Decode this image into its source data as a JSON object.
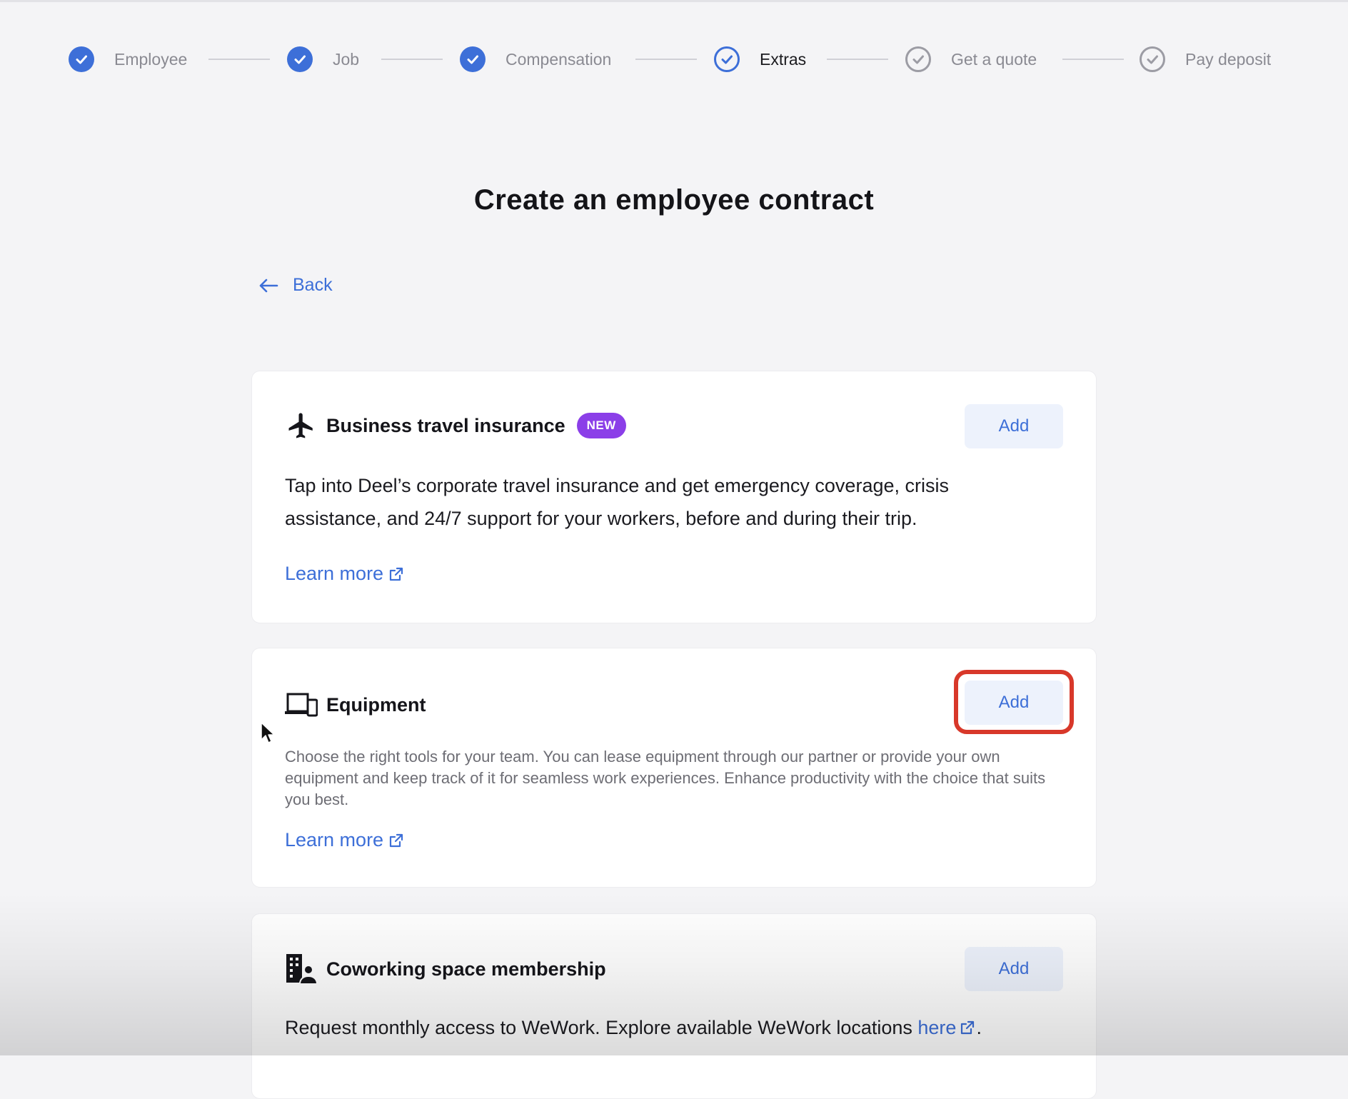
{
  "stepper": {
    "steps": [
      {
        "label": "Employee",
        "state": "done"
      },
      {
        "label": "Job",
        "state": "done"
      },
      {
        "label": "Compensation",
        "state": "done"
      },
      {
        "label": "Extras",
        "state": "active"
      },
      {
        "label": "Get a quote",
        "state": "todo"
      },
      {
        "label": "Pay deposit",
        "state": "todo"
      }
    ]
  },
  "page": {
    "title": "Create an employee contract",
    "back_label": "Back"
  },
  "cards": [
    {
      "icon": "airplane-icon",
      "title": "Business travel insurance",
      "badge": "NEW",
      "button": "Add",
      "description": "Tap into Deel’s corporate travel insurance and get emergency coverage, crisis assistance, and 24/7 support for your workers, before and during their trip.",
      "link": "Learn more"
    },
    {
      "icon": "devices-icon",
      "title": "Equipment",
      "button": "Add",
      "description": "Choose the right tools for your team. You can lease equipment through our partner or provide your own equipment and keep track of it for seamless work experiences. Enhance productivity with the choice that suits you best.",
      "link": "Learn more"
    },
    {
      "icon": "office-building-person-icon",
      "title": "Coworking space membership",
      "button": "Add",
      "description": "Request monthly access to WeWork. Explore available WeWork locations ",
      "description_link": "here",
      "description_end": "."
    }
  ],
  "colors": {
    "accent": "#3d6fd8",
    "badge": "#8b3fe8",
    "highlight": "#d8382a",
    "background": "#f4f4f6"
  }
}
